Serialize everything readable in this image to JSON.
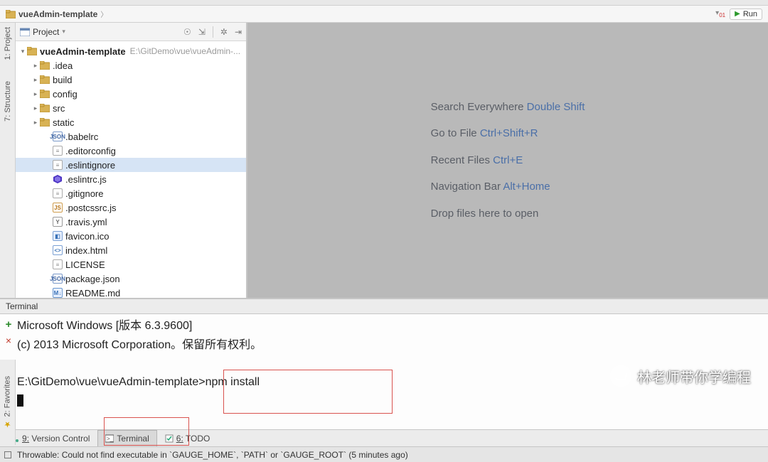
{
  "breadcrumb": {
    "root": "vueAdmin-template"
  },
  "run_button": {
    "label": "Run"
  },
  "side_tabs": {
    "project": "1: Project",
    "structure": "7: Structure",
    "favorites": "2: Favorites"
  },
  "project_panel": {
    "title": "Project"
  },
  "tree": {
    "root": {
      "name": "vueAdmin-template",
      "path": "E:\\GitDemo\\vue\\vueAdmin-..."
    },
    "folders": [
      {
        "name": ".idea"
      },
      {
        "name": "build"
      },
      {
        "name": "config"
      },
      {
        "name": "src"
      },
      {
        "name": "static"
      }
    ],
    "files": [
      {
        "name": ".babelrc",
        "icon": "json"
      },
      {
        "name": ".editorconfig",
        "icon": "txt"
      },
      {
        "name": ".eslintignore",
        "icon": "txt",
        "selected": true
      },
      {
        "name": ".eslintrc.js",
        "icon": "eslint"
      },
      {
        "name": ".gitignore",
        "icon": "txt"
      },
      {
        "name": ".postcssrc.js",
        "icon": "js"
      },
      {
        "name": ".travis.yml",
        "icon": "yml"
      },
      {
        "name": "favicon.ico",
        "icon": "ico"
      },
      {
        "name": "index.html",
        "icon": "html"
      },
      {
        "name": "LICENSE",
        "icon": "txt"
      },
      {
        "name": "package.json",
        "icon": "json"
      },
      {
        "name": "README.md",
        "icon": "md"
      }
    ]
  },
  "welcome": {
    "l1a": "Search Everywhere ",
    "l1b": "Double Shift",
    "l2a": "Go to File ",
    "l2b": "Ctrl+Shift+R",
    "l3a": "Recent Files ",
    "l3b": "Ctrl+E",
    "l4a": "Navigation Bar ",
    "l4b": "Alt+Home",
    "l5": "Drop files here to open"
  },
  "terminal": {
    "title": "Terminal",
    "line1": "Microsoft Windows [版本 6.3.9600]",
    "line2": "(c) 2013 Microsoft Corporation。保留所有权利。",
    "prompt": "E:\\GitDemo\\vue\\vueAdmin-template>",
    "command": "npm install"
  },
  "bottom_tabs": {
    "vcs": {
      "key": "9:",
      "label": "Version Control"
    },
    "terminal": {
      "label": "Terminal"
    },
    "todo": {
      "key": "6:",
      "label": "TODO"
    }
  },
  "status": {
    "msg": "Throwable: Could not find executable in `GAUGE_HOME`, `PATH` or `GAUGE_ROOT` (5 minutes ago)"
  },
  "watermark": "林老师带你学编程"
}
